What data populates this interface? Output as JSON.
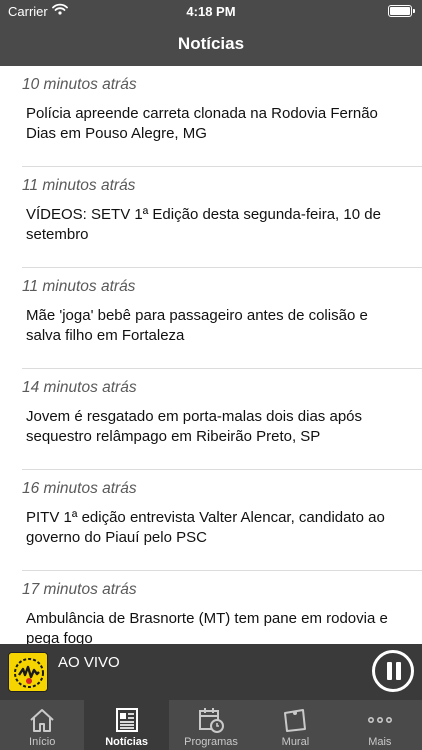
{
  "status_bar": {
    "carrier": "Carrier",
    "time": "4:18 PM"
  },
  "nav": {
    "title": "Notícias"
  },
  "news": [
    {
      "time": "10 minutos atrás",
      "headline": "Polícia apreende carreta clonada na Rodovia Fernão Dias em Pouso Alegre, MG"
    },
    {
      "time": "11 minutos atrás",
      "headline": "VÍDEOS: SETV 1ª Edição desta segunda-feira, 10 de setembro"
    },
    {
      "time": "11 minutos atrás",
      "headline": "Mãe 'joga' bebê para passageiro antes de colisão e salva filho em Fortaleza"
    },
    {
      "time": "14 minutos atrás",
      "headline": "Jovem é resgatado em porta-malas dois dias após sequestro relâmpago em Ribeirão Preto, SP"
    },
    {
      "time": "16 minutos atrás",
      "headline": "PITV 1ª edição entrevista Valter Alencar, candidato ao governo do Piauí pelo PSC"
    },
    {
      "time": "17 minutos atrás",
      "headline": "Ambulância de Brasnorte (MT) tem pane em rodovia e pega fogo"
    }
  ],
  "player": {
    "live_label": "AO VIVO",
    "logo_icon": "radio-logo-icon",
    "pause_icon": "pause-icon"
  },
  "tabs": [
    {
      "label": "Início",
      "icon": "home-icon",
      "active": false
    },
    {
      "label": "Notícias",
      "icon": "newspaper-icon",
      "active": true
    },
    {
      "label": "Programas",
      "icon": "calendar-icon",
      "active": false
    },
    {
      "label": "Mural",
      "icon": "mural-icon",
      "active": false
    },
    {
      "label": "Mais",
      "icon": "more-icon",
      "active": false
    }
  ],
  "colors": {
    "bar": "#4a4a4a",
    "player": "#3a3a3a",
    "logo": "#f5d400"
  }
}
